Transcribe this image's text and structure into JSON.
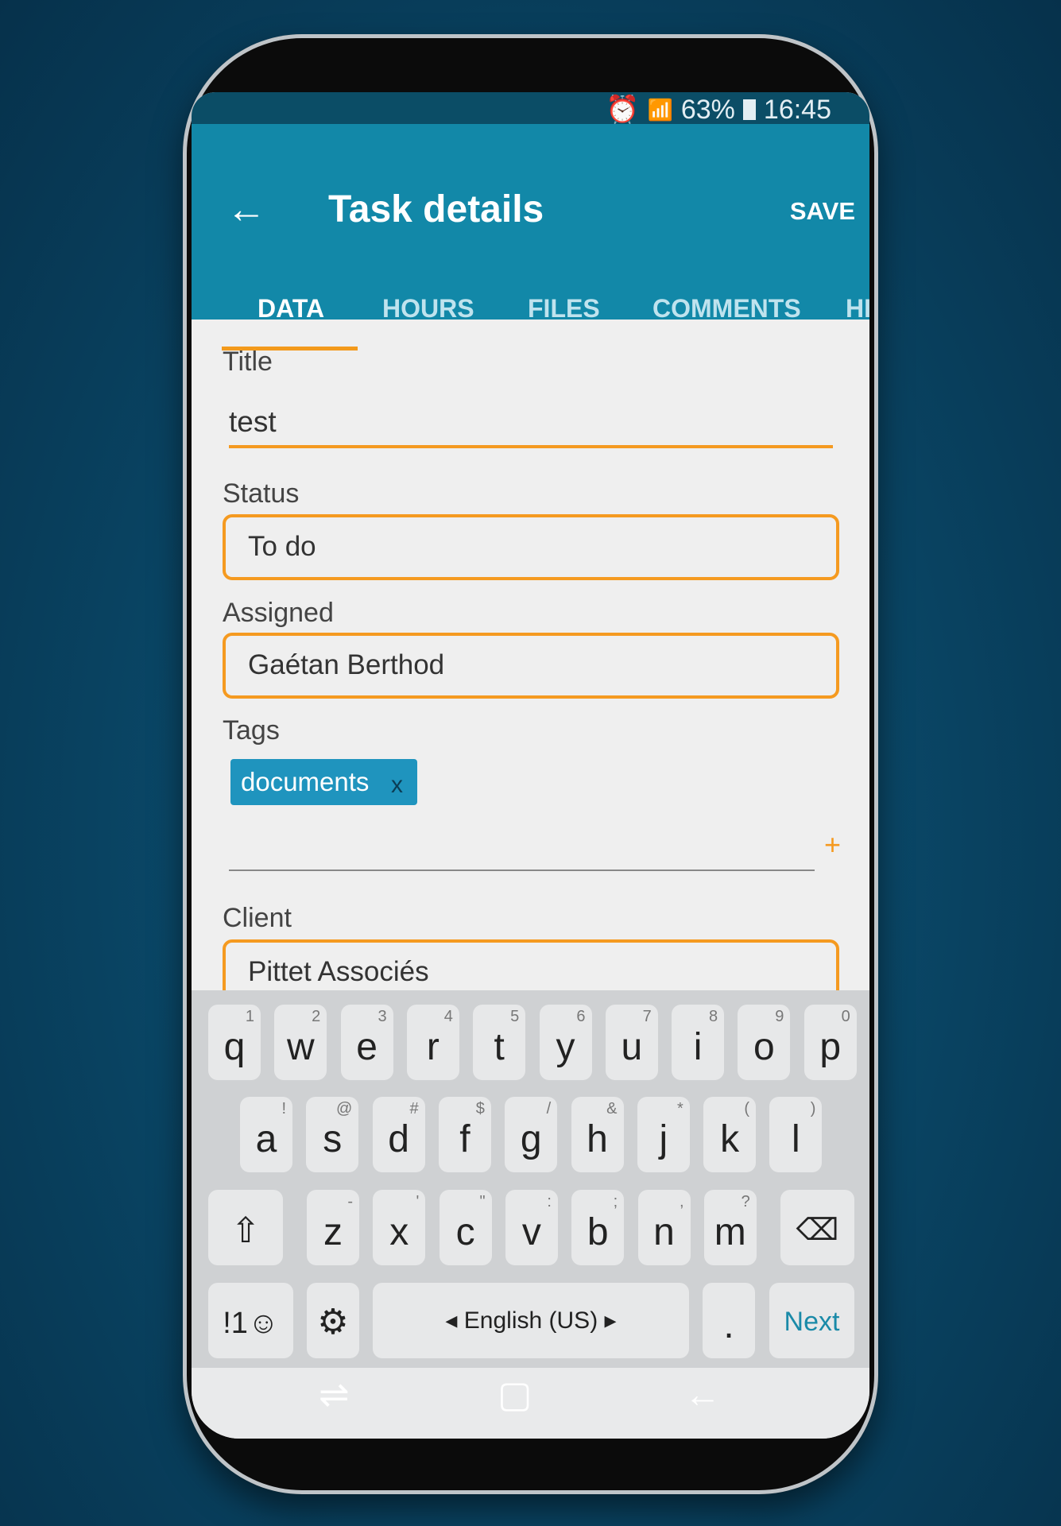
{
  "status_bar": {
    "battery": "63%",
    "time": "16:45",
    "icons": [
      "alarm-icon",
      "wifi-icon",
      "signal-icon",
      "battery-icon"
    ]
  },
  "app_bar": {
    "title": "Task details",
    "save_label": "SAVE",
    "back_icon": "arrow-left-icon"
  },
  "tabs": [
    {
      "label": "DATA",
      "active": true
    },
    {
      "label": "HOURS"
    },
    {
      "label": "FILES"
    },
    {
      "label": "COMMENTS"
    },
    {
      "label": "HI"
    }
  ],
  "form": {
    "title_label": "Title",
    "title_value": "test",
    "status_label": "Status",
    "status_value": "To do",
    "assigned_label": "Assigned",
    "assigned_value": "Gaétan Berthod",
    "tags_label": "Tags",
    "tags": [
      {
        "label": "documents",
        "remove": "x"
      }
    ],
    "add_tag": "+",
    "client_label": "Client",
    "client_value": "Pittet Associés"
  },
  "colors": {
    "primary": "#1288a8",
    "accent": "#f59a20",
    "chip": "#1f94be"
  },
  "keyboard": {
    "row1": [
      [
        "q",
        "1"
      ],
      [
        "w",
        "2"
      ],
      [
        "e",
        "3"
      ],
      [
        "r",
        "4"
      ],
      [
        "t",
        "5"
      ],
      [
        "y",
        "6"
      ],
      [
        "u",
        "7"
      ],
      [
        "i",
        "8"
      ],
      [
        "o",
        "9"
      ],
      [
        "p",
        "0"
      ]
    ],
    "row2": [
      [
        "a",
        "!"
      ],
      [
        "s",
        "@"
      ],
      [
        "d",
        "#"
      ],
      [
        "f",
        "$"
      ],
      [
        "g",
        "/"
      ],
      [
        "h",
        "&"
      ],
      [
        "j",
        "*"
      ],
      [
        "k",
        "("
      ],
      [
        "l",
        ")"
      ]
    ],
    "row3": [
      [
        "z",
        "-"
      ],
      [
        "x",
        "'"
      ],
      [
        "c",
        "\""
      ],
      [
        "v",
        ":"
      ],
      [
        "b",
        ";"
      ],
      [
        "n",
        ","
      ],
      [
        "m",
        "?"
      ]
    ],
    "symbols_label": "!1☺",
    "language": "English (US)",
    "period": ".",
    "next_label": "Next"
  }
}
